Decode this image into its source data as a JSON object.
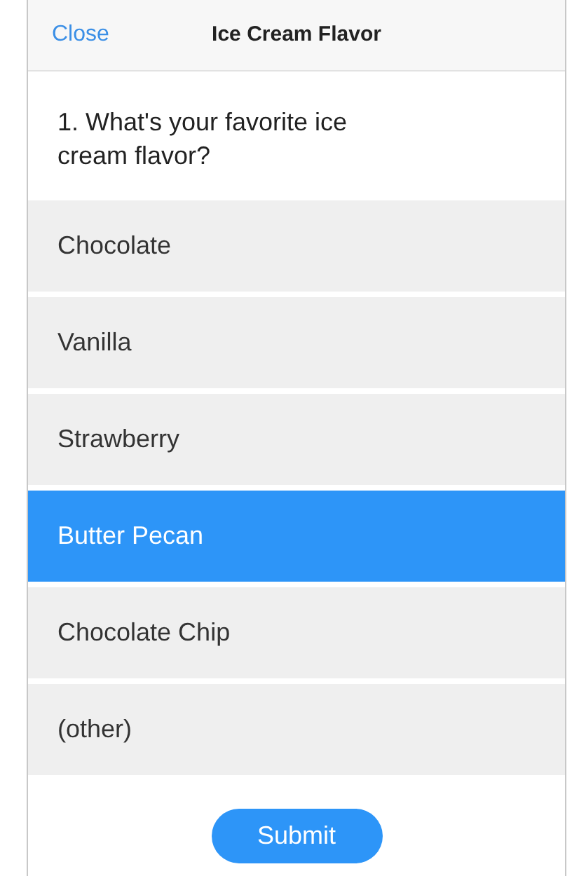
{
  "header": {
    "close": "Close",
    "title": "Ice Cream Flavor"
  },
  "question": "1. What's your favorite ice cream flavor?",
  "options": [
    {
      "label": "Chocolate",
      "selected": false
    },
    {
      "label": "Vanilla",
      "selected": false
    },
    {
      "label": "Strawberry",
      "selected": false
    },
    {
      "label": "Butter Pecan",
      "selected": true
    },
    {
      "label": "Chocolate Chip",
      "selected": false
    },
    {
      "label": "(other)",
      "selected": false
    }
  ],
  "submit": "Submit"
}
